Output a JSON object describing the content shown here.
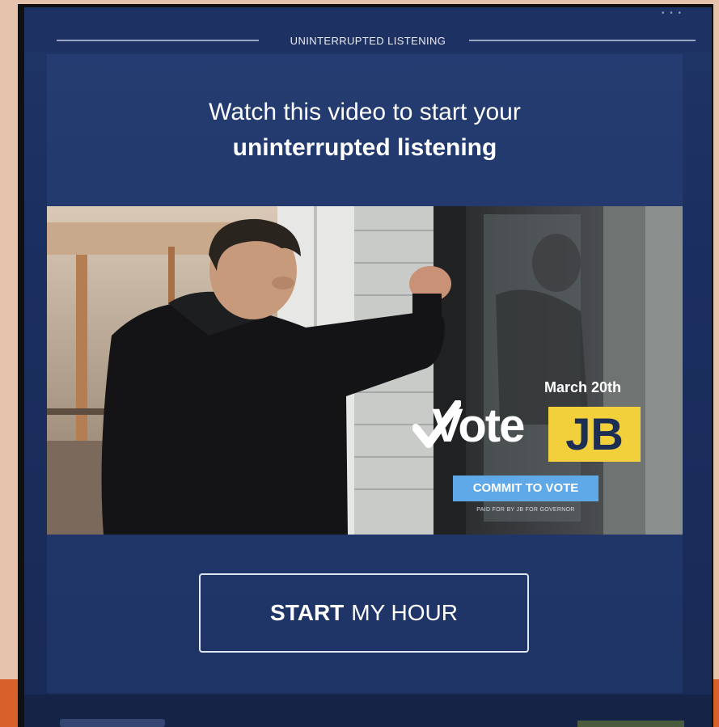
{
  "header": {
    "label": "UNINTERRUPTED LISTENING"
  },
  "promo": {
    "headline_line1": "Watch this video to start your",
    "headline_line2": "uninterrupted listening"
  },
  "ad": {
    "date": "March 20th",
    "brand_vote": "Vote",
    "brand_jb": "JB",
    "commit_label": "COMMIT TO VOTE",
    "paid_for": "PAID FOR BY JB FOR GOVERNOR"
  },
  "cta": {
    "bold": "START",
    "rest": "MY HOUR"
  }
}
